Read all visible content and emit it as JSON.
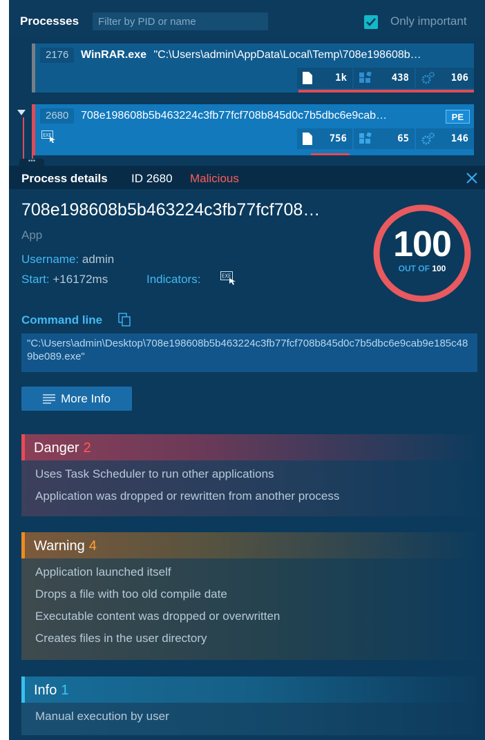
{
  "processes": {
    "title": "Processes",
    "filter_placeholder": "Filter by PID or name",
    "only_important": "Only important",
    "only_important_checked": true,
    "rows": [
      {
        "pid": "2176",
        "name": "WinRAR.exe",
        "command": "\"C:\\Users\\admin\\AppData\\Local\\Temp\\708e198608b…",
        "files": "1k",
        "registry": "438",
        "modules": "106"
      },
      {
        "pid": "2680",
        "name": "708e198608b5b463224c3fb77fcf708b845d0c7b5dbc6e9cab…",
        "badge": "PE",
        "files": "756",
        "registry": "65",
        "modules": "146"
      }
    ]
  },
  "details": {
    "title": "Process details",
    "id_label": "ID 2680",
    "status": "Malicious",
    "name": "708e198608b5b463224c3fb77fcf708…",
    "type": "App",
    "username_label": "Username:",
    "username": "admin",
    "start_label": "Start:",
    "start": "+16172ms",
    "indicators_label": "Indicators:",
    "score": "100",
    "score_out_of": "OUT OF",
    "score_max": "100",
    "command_line_label": "Command line",
    "command_line": "\"C:\\Users\\admin\\Desktop\\708e198608b5b463224c3fb77fcf708b845d0c7b5dbc6e9cab9e185c489be089.exe\"",
    "more_info": "More Info"
  },
  "sections": {
    "danger": {
      "label": "Danger",
      "count": "2",
      "items": [
        "Uses Task Scheduler to run other applications",
        "Application was dropped or rewritten from another process"
      ]
    },
    "warning": {
      "label": "Warning",
      "count": "4",
      "items": [
        "Application launched itself",
        "Drops a file with too old compile date",
        "Executable content was dropped or overwritten",
        "Creates files in the user directory"
      ]
    },
    "info": {
      "label": "Info",
      "count": "1",
      "items": [
        "Manual execution by user"
      ]
    }
  },
  "colors": {
    "background": "#0b3a5c",
    "malicious": "#ff5b5b",
    "danger": "#e84a55",
    "warning": "#f08a1f",
    "info": "#38c0ef",
    "accent": "#44b8f2"
  },
  "icons": {
    "checkbox": "check-icon",
    "files": "file-icon",
    "registry": "registry-icon",
    "modules": "gears-icon",
    "exe": "exe-icon",
    "close": "close-icon",
    "copy": "copy-icon",
    "more": "menu-lines-icon"
  }
}
